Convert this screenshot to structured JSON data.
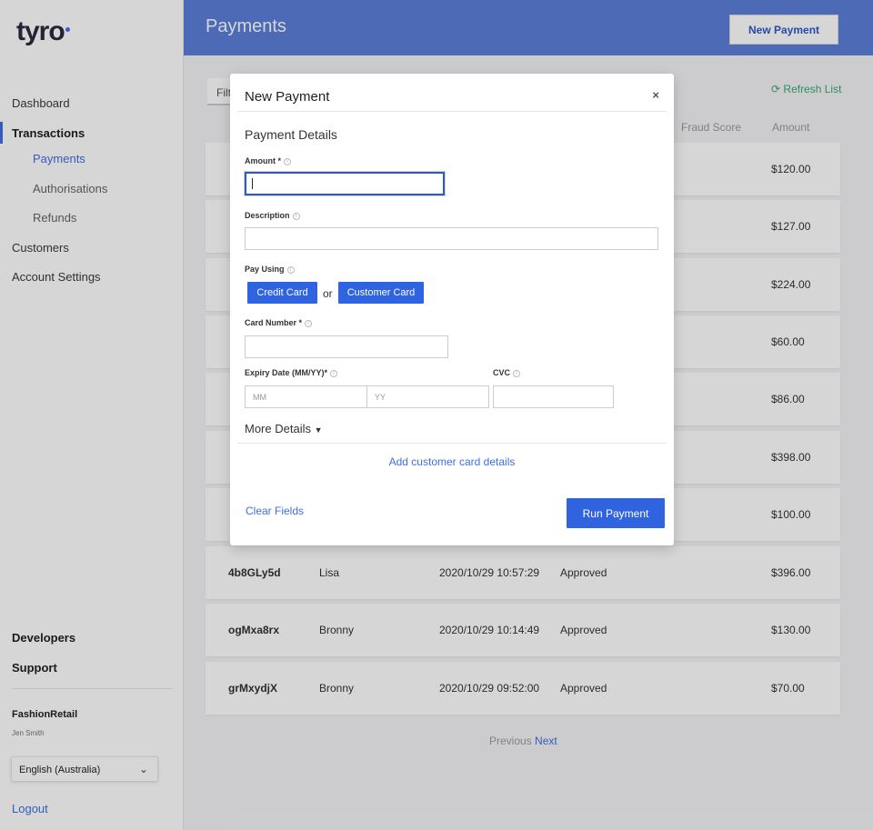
{
  "app": {
    "logo": "tyro"
  },
  "sidebar": {
    "items": [
      {
        "label": "Dashboard"
      },
      {
        "label": "Transactions"
      },
      {
        "label": "Payments"
      },
      {
        "label": "Authorisations"
      },
      {
        "label": "Refunds"
      },
      {
        "label": "Customers"
      },
      {
        "label": "Account Settings"
      }
    ],
    "developers": "Developers",
    "support": "Support",
    "org": "FashionRetail",
    "user": "Jen Smith",
    "language": "English (Australia)",
    "logout": "Logout"
  },
  "header": {
    "title": "Payments",
    "new_payment": "New Payment"
  },
  "list": {
    "filter_placeholder": "Filt",
    "refresh": "Refresh List",
    "columns": {
      "fraud_score": "Fraud Score",
      "amount": "Amount"
    },
    "hidden_rows": [
      {
        "amount": "$120.00"
      },
      {
        "amount": "$127.00"
      },
      {
        "amount": "$224.00"
      },
      {
        "amount": "$60.00"
      },
      {
        "amount": "$86.00"
      },
      {
        "amount": "$398.00"
      },
      {
        "amount": "$100.00"
      }
    ],
    "rows": [
      {
        "id": "4b8GLy5d",
        "name": "Lisa",
        "date": "2020/10/29 10:57:29",
        "status": "Approved",
        "amount": "$396.00"
      },
      {
        "id": "ogMxa8rx",
        "name": "Bronny",
        "date": "2020/10/29 10:14:49",
        "status": "Approved",
        "amount": "$130.00"
      },
      {
        "id": "grMxydjX",
        "name": "Bronny",
        "date": "2020/10/29 09:52:00",
        "status": "Approved",
        "amount": "$70.00"
      }
    ],
    "pager": {
      "previous": "Previous",
      "next": "Next"
    }
  },
  "modal": {
    "title": "New Payment",
    "close": "×",
    "section": "Payment Details",
    "amount_label": "Amount *",
    "description_label": "Description",
    "pay_using_label": "Pay Using",
    "credit_card": "Credit Card",
    "or": "or",
    "customer_card": "Customer Card",
    "card_number_label": "Card Number *",
    "expiry_label": "Expiry Date (MM/YY)*",
    "mm_placeholder": "MM",
    "yy_placeholder": "YY",
    "cvc_label": "CVC",
    "more_details": "More Details",
    "add_card": "Add customer card details",
    "clear": "Clear Fields",
    "run": "Run Payment"
  }
}
